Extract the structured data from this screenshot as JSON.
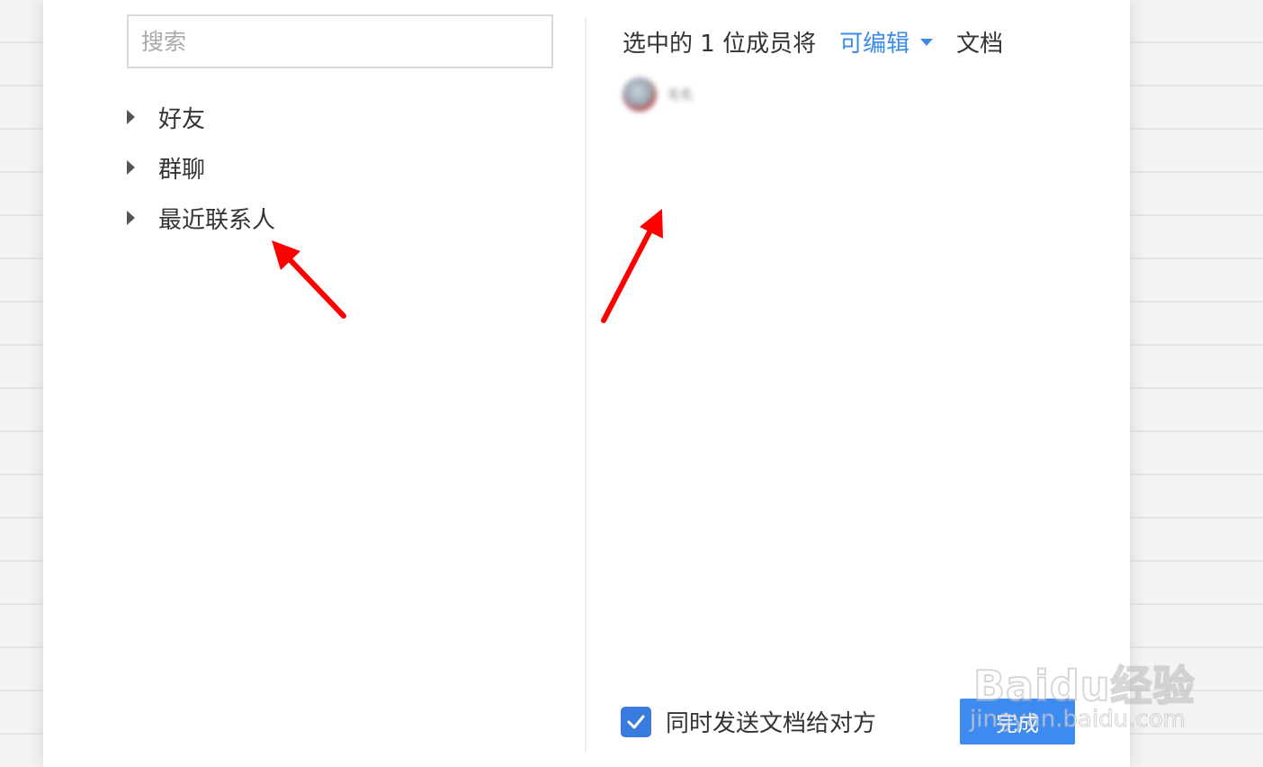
{
  "search": {
    "placeholder": "搜索"
  },
  "tree": {
    "items": [
      {
        "label": "好友"
      },
      {
        "label": "群聊"
      },
      {
        "label": "最近联系人"
      }
    ]
  },
  "permission": {
    "prefix": "选中的 1 位成员将",
    "level": "可编辑",
    "suffix": "文档"
  },
  "member": {
    "name": "毛毛"
  },
  "footer": {
    "send_label": "同时发送文档给对方",
    "send_checked": true,
    "done_label": "完成"
  },
  "colors": {
    "accent": "#3c8be6",
    "button": "#3d8af0",
    "arrow": "#ff0000"
  },
  "watermark": {
    "brand": "Baidu经验",
    "url": "jingyan.baidu.com"
  }
}
